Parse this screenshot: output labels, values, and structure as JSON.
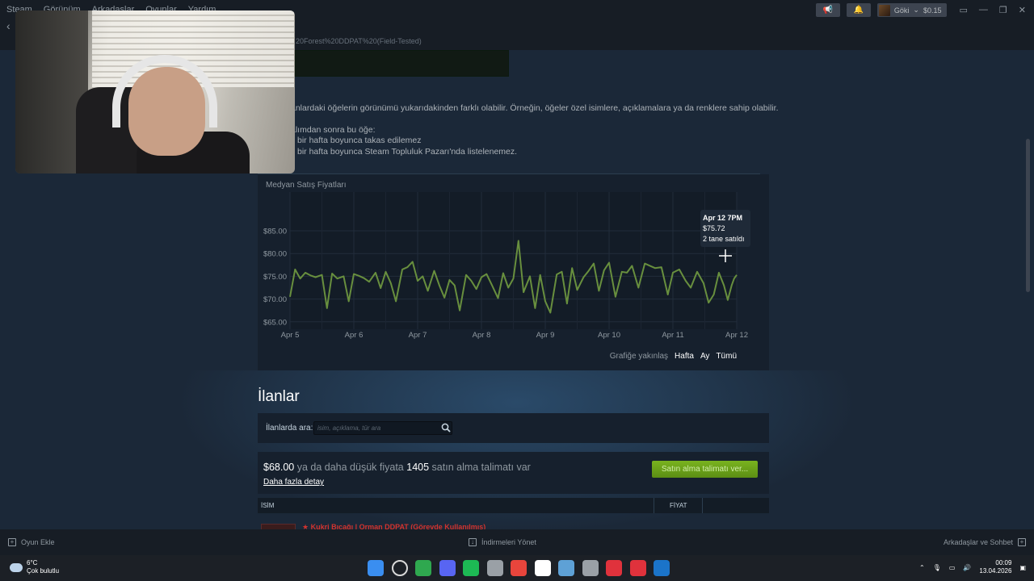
{
  "titlebar": {
    "menu": [
      "Steam",
      "Görünüm",
      "Arkadaşlar",
      "Oyunlar",
      "Yardım"
    ],
    "url_fragment": "20Forest%20DDPAT%20(Field-Tested)",
    "user_name": "Göki",
    "wallet": "$0.15"
  },
  "notice": {
    "line1": "anlardaki öğelerin görünümü yukarıdakinden farklı olabilir. Örneğin, öğeler özel isimlere, açıklamalara ya da renklere sahip olabilir.",
    "line2": "alımdan sonra bu öğe:",
    "bullet1": "bir hafta boyunca takas edilemez",
    "bullet2": "bir hafta boyunca Steam Topluluk Pazarı'nda listelenemez."
  },
  "chart": {
    "title": "Medyan Satış Fiyatları",
    "zoom_label": "Grafiğe yakınlaş",
    "zoom_options": [
      "Hafta",
      "Ay",
      "Tümü"
    ],
    "tooltip": {
      "date": "Apr 12 7PM",
      "price": "$75.72",
      "sold": "2 tane satıldı"
    }
  },
  "chart_data": {
    "type": "line",
    "title": "Medyan Satış Fiyatları",
    "xlabel": "",
    "ylabel": "",
    "x_ticks": [
      "Apr 5",
      "Apr 6",
      "Apr 7",
      "Apr 8",
      "Apr 9",
      "Apr 10",
      "Apr 11",
      "Apr 12"
    ],
    "y_ticks": [
      "$65.00",
      "$70.00",
      "$75.00",
      "$80.00",
      "$85.00"
    ],
    "ylim": [
      60,
      90
    ],
    "grid": true,
    "series": [
      {
        "color": "#688f3e",
        "x_days": [
          0,
          0.08,
          0.16,
          0.24,
          0.32,
          0.4,
          0.5,
          0.58,
          0.66,
          0.74,
          0.84,
          0.92,
          1.0,
          1.08,
          1.16,
          1.24,
          1.34,
          1.42,
          1.5,
          1.58,
          1.66,
          1.76,
          1.84,
          1.92,
          2.0,
          2.08,
          2.16,
          2.26,
          2.34,
          2.42,
          2.5,
          2.58,
          2.66,
          2.76,
          2.84,
          2.92,
          3.0,
          3.08,
          3.16,
          3.26,
          3.34,
          3.42,
          3.5,
          3.58,
          3.66,
          3.76,
          3.84,
          3.92,
          4.0,
          4.08,
          4.18,
          4.26,
          4.34,
          4.42,
          4.5,
          4.6,
          4.68,
          4.76,
          4.84,
          4.92,
          5.0,
          5.1,
          5.2,
          5.28,
          5.36,
          5.46,
          5.56,
          5.64,
          5.72,
          5.82,
          5.92,
          6.0,
          6.1,
          6.2,
          6.28,
          6.38,
          6.48,
          6.56,
          6.64,
          6.72,
          6.8,
          6.86,
          6.92,
          6.96,
          7.0
        ],
        "values": [
          70.5,
          76.5,
          74.5,
          75.8,
          75.2,
          74.8,
          75.3,
          68.0,
          75.6,
          74.5,
          75.0,
          69.5,
          75.5,
          75.1,
          74.6,
          73.8,
          75.8,
          72.4,
          76.0,
          73.5,
          69.5,
          76.5,
          77.0,
          78.2,
          74.0,
          75.0,
          71.8,
          76.2,
          73.0,
          70.3,
          74.2,
          73.0,
          67.5,
          75.3,
          74.0,
          72.2,
          74.8,
          75.5,
          73.2,
          70.2,
          75.7,
          72.5,
          74.5,
          82.8,
          71.5,
          75.0,
          68.0,
          75.3,
          69.5,
          67.0,
          75.4,
          76.0,
          69.0,
          76.8,
          72.0,
          74.8,
          76.2,
          77.8,
          71.8,
          76.3,
          78.0,
          70.5,
          76.0,
          75.8,
          77.3,
          72.5,
          77.8,
          77.3,
          76.8,
          77.0,
          71.0,
          75.8,
          76.5,
          74.0,
          72.5,
          76.0,
          73.5,
          69.2,
          71.0,
          75.8,
          73.0,
          69.8,
          73.0,
          74.5,
          75.3
        ]
      }
    ]
  },
  "listings": {
    "title": "İlanlar",
    "search_label": "İlanlarda ara:",
    "search_placeholder": "isim, açıklama, tür ara",
    "order_price": "$68.00",
    "order_mid": "ya da daha düşük fiyata",
    "order_count": "1405",
    "order_suffix": "satın alma talimatı var",
    "details_link": "Daha fazla detay",
    "buy_button": "Satın alma talimatı ver...",
    "col_name": "İSİM",
    "col_price": "FİYAT",
    "row_name": "★ Kukri Bıçağı | Orman DDPAT (Görevde Kullanılmış)"
  },
  "bottombar": {
    "add_game": "Oyun Ekle",
    "downloads": "İndirmeleri Yönet",
    "friends": "Arkadaşlar ve Sohbet"
  },
  "taskbar": {
    "temperature": "6°C",
    "weather": "Çok bulutlu",
    "time": "00:09",
    "date": "13.04.2026",
    "icon_colors": [
      "#3a8ef0",
      "#d9d9d9",
      "#2fa84f",
      "#5865f2",
      "#1db954",
      "#9aa0a6",
      "#e8453c",
      "#ffffff",
      "#5ea1d6",
      "#9aa0a6",
      "#e0323c",
      "#e0323c",
      "#1b74c9"
    ]
  }
}
